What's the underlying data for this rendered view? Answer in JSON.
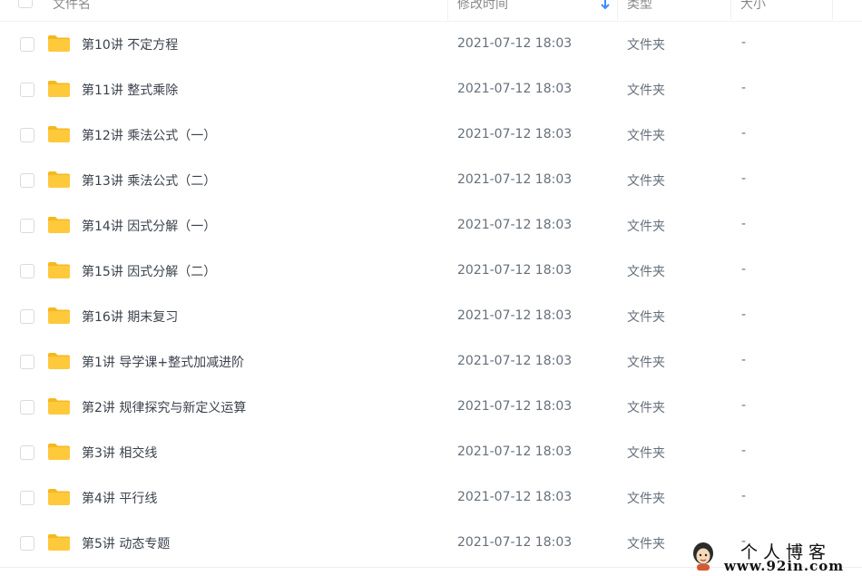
{
  "header": {
    "col_name": "文件名",
    "col_modified": "修改时间",
    "col_type": "类型",
    "col_size": "大小",
    "sort_icon": "arrow-down-icon"
  },
  "rows": [
    {
      "name": "第10讲 不定方程",
      "modified": "2021-07-12 18:03",
      "type": "文件夹",
      "size": "-"
    },
    {
      "name": "第11讲 整式乘除",
      "modified": "2021-07-12 18:03",
      "type": "文件夹",
      "size": "-"
    },
    {
      "name": "第12讲 乘法公式（一）",
      "modified": "2021-07-12 18:03",
      "type": "文件夹",
      "size": "-"
    },
    {
      "name": "第13讲 乘法公式（二）",
      "modified": "2021-07-12 18:03",
      "type": "文件夹",
      "size": "-"
    },
    {
      "name": "第14讲 因式分解（一）",
      "modified": "2021-07-12 18:03",
      "type": "文件夹",
      "size": "-"
    },
    {
      "name": "第15讲 因式分解（二）",
      "modified": "2021-07-12 18:03",
      "type": "文件夹",
      "size": "-"
    },
    {
      "name": "第16讲 期末复习",
      "modified": "2021-07-12 18:03",
      "type": "文件夹",
      "size": "-"
    },
    {
      "name": "第1讲 导学课+整式加减进阶",
      "modified": "2021-07-12 18:03",
      "type": "文件夹",
      "size": "-"
    },
    {
      "name": "第2讲 规律探究与新定义运算",
      "modified": "2021-07-12 18:03",
      "type": "文件夹",
      "size": "-"
    },
    {
      "name": "第3讲 相交线",
      "modified": "2021-07-12 18:03",
      "type": "文件夹",
      "size": "-"
    },
    {
      "name": "第4讲 平行线",
      "modified": "2021-07-12 18:03",
      "type": "文件夹",
      "size": "-"
    },
    {
      "name": "第5讲 动态专题",
      "modified": "2021-07-12 18:03",
      "type": "文件夹",
      "size": "-"
    }
  ],
  "icons": {
    "folder": "folder-icon",
    "checkbox": "checkbox-icon"
  },
  "watermark": {
    "title": "个人博客",
    "url": "www.92in.com"
  },
  "colors": {
    "folder": "#ffc93c",
    "folder_dark": "#f5b81f",
    "sort_arrow": "#3b8cff"
  }
}
